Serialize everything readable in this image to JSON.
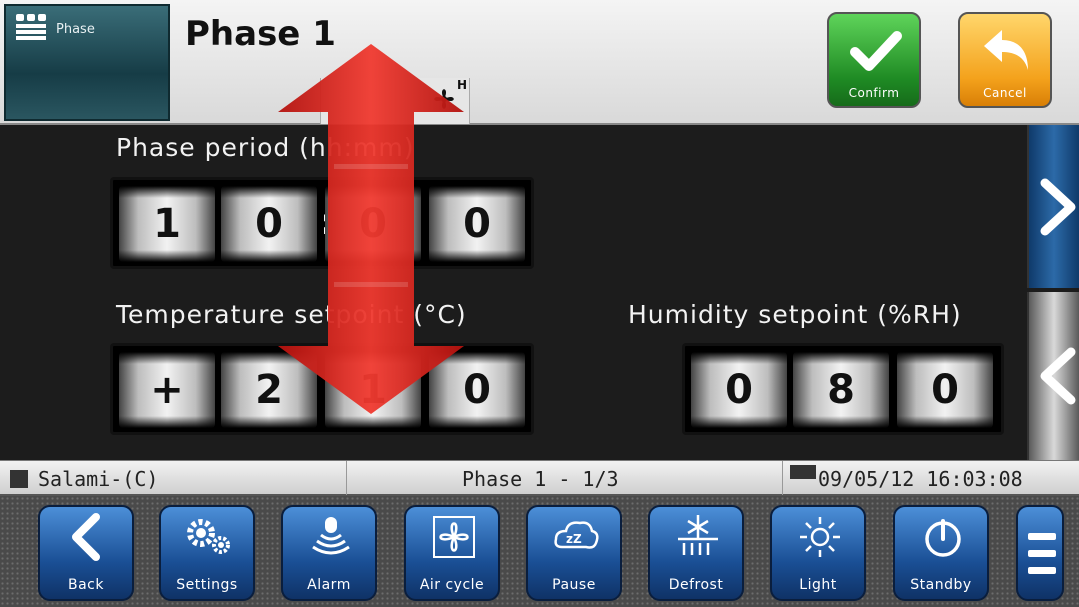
{
  "header": {
    "menu_label": "Phase",
    "title": "Phase 1",
    "fan_indicator": "H",
    "confirm_label": "Confirm",
    "cancel_label": "Cancel"
  },
  "main": {
    "phase_period": {
      "label": "Phase period (hh:mm)",
      "digits": [
        "1",
        "0",
        "0",
        "0"
      ],
      "separator": ":"
    },
    "temperature": {
      "label": "Temperature setpoint (°C)",
      "digits": [
        "+",
        "2",
        "1",
        "0"
      ],
      "separator": "."
    },
    "humidity": {
      "label": "Humidity setpoint (%RH)",
      "digits": [
        "0",
        "8",
        "0"
      ]
    }
  },
  "status": {
    "recipe": "Salami-(C)",
    "phase": "Phase 1 - 1/3",
    "datetime": "09/05/12 16:03:08"
  },
  "toolbar": {
    "back": "Back",
    "settings": "Settings",
    "alarm": "Alarm",
    "air_cycle": "Air cycle",
    "pause": "Pause",
    "defrost": "Defrost",
    "light": "Light",
    "standby": "Standby"
  },
  "colors": {
    "confirm": "#2aa02f",
    "cancel": "#f4a21c",
    "toolbar_button": "#1a4f95",
    "arrow": "#e0221c"
  }
}
